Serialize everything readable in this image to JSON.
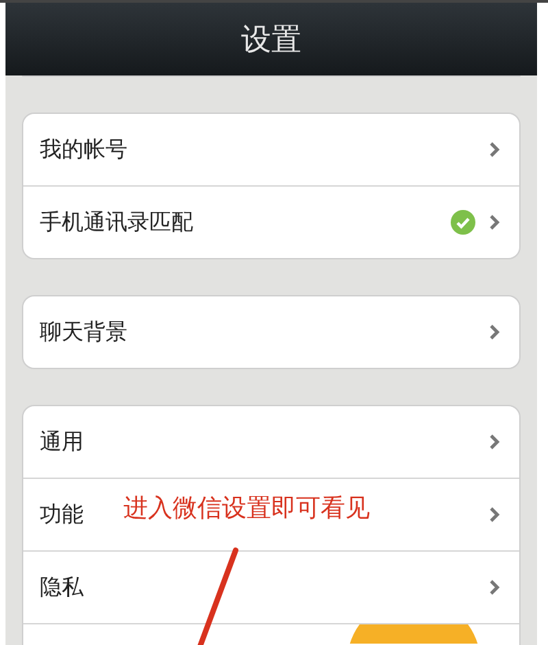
{
  "header": {
    "title": "设置"
  },
  "groups": [
    {
      "rows": [
        {
          "label": "我的帐号",
          "verified": false
        },
        {
          "label": "手机通讯录匹配",
          "verified": true
        }
      ]
    },
    {
      "rows": [
        {
          "label": "聊天背景",
          "verified": false
        }
      ]
    },
    {
      "rows": [
        {
          "label": "通用",
          "verified": false
        },
        {
          "label": "功能",
          "verified": false
        },
        {
          "label": "隐私",
          "verified": false
        }
      ]
    }
  ],
  "annotation": {
    "text": "进入微信设置即可看见"
  }
}
